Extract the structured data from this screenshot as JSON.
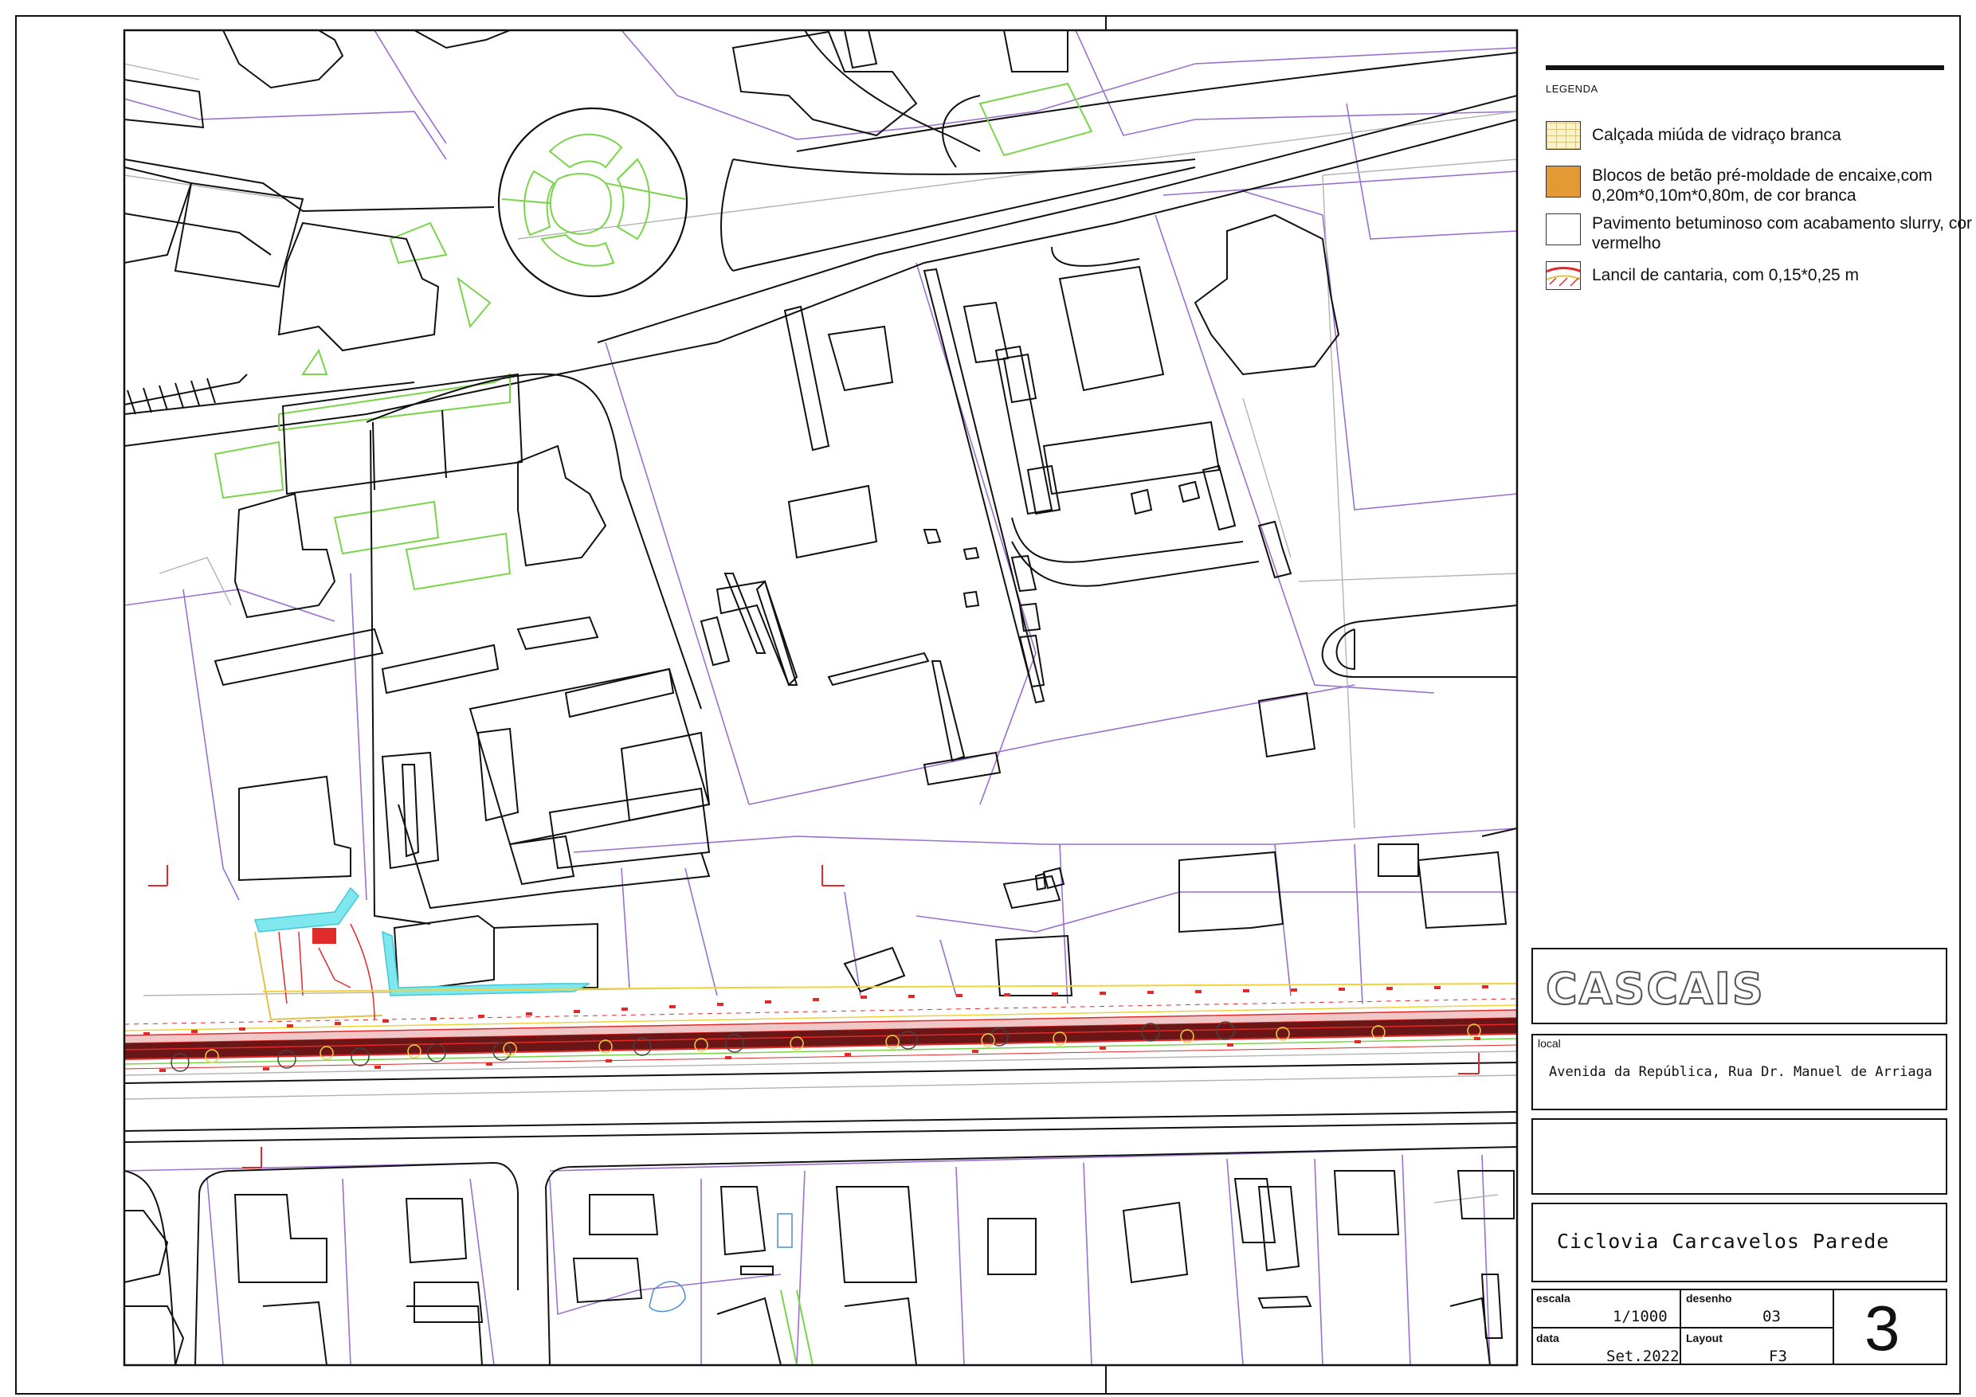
{
  "legend": {
    "title": "LEGENDA",
    "items": [
      {
        "label": "Calçada miúda de vidraço branca",
        "swatch_color": "#fbf3c7",
        "swatch_pattern": "brick"
      },
      {
        "label": "Blocos de betão pré-moldade de encaixe,com 0,20m*0,10m*0,80m, de cor branca",
        "swatch_color": "#e39a34",
        "swatch_pattern": "solid"
      },
      {
        "label": "Pavimento betuminoso com acabamento slurry, cor vermelho",
        "swatch_color": "#ffffff",
        "swatch_pattern": "solid"
      },
      {
        "label": "Lancil de cantaria, com 0,15*0,25 m",
        "swatch_color": "#ffffff",
        "swatch_pattern": "curb"
      }
    ]
  },
  "title_block": {
    "brand": "CASCAIS",
    "local_label": "local",
    "local_value": "Avenida da República, Rua Dr. Manuel de Arriaga",
    "project": "Ciclovia Carcavelos Parede",
    "escala_label": "escala",
    "escala_value": "1/1000",
    "desenho_label": "desenho",
    "desenho_value": "03",
    "data_label": "data",
    "data_value": "Set.2022",
    "layout_label": "Layout",
    "layout_value": "F3",
    "sheet_number": "3"
  },
  "colors": {
    "building_outline": "#111111",
    "parcel_line": "#9b6fcf",
    "green_area": "#7ad44a",
    "water": "#7fe7ee",
    "road_red": "#e22a2a",
    "road_dark": "#6b1616",
    "guide_gray": "#aaaaaa",
    "yellow_line": "#f0d23c"
  }
}
